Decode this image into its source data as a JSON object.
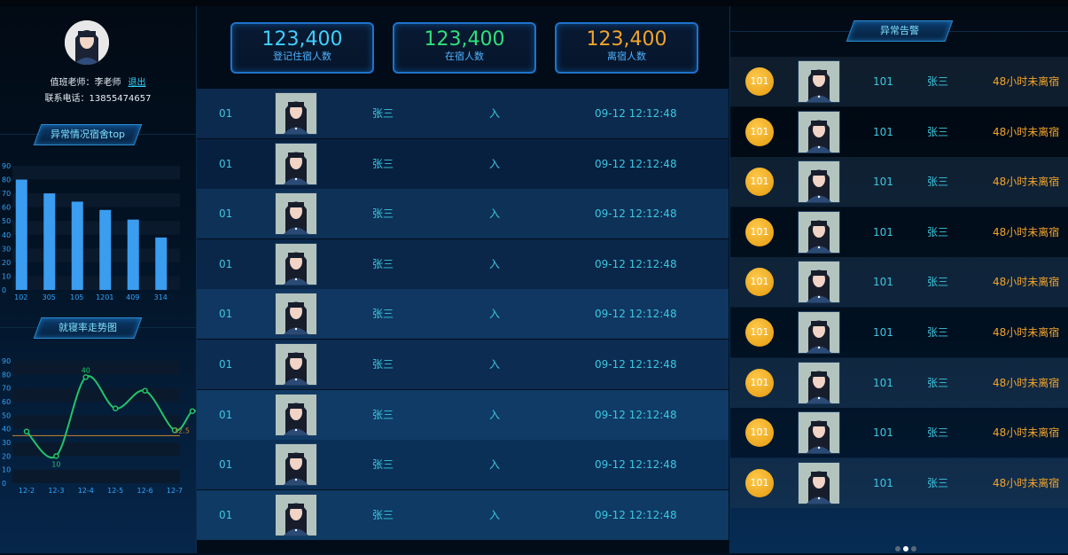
{
  "colors": {
    "accent": "#2fd6ff",
    "bar": "#3a9df0",
    "line": "#22c46b",
    "alert": "#f2a42a",
    "card1": "#3fd0ff",
    "card2": "#2fe07a",
    "card3": "#f2a42a"
  },
  "profile": {
    "teacher_label": "值班老师：李老师",
    "logout_label": "退出",
    "phone_label": "联系电话：13855474657"
  },
  "left": {
    "top_title": "异常情况宿舍top",
    "trend_title": "就寝率走势图"
  },
  "stats": [
    {
      "value": "123,400",
      "label": "登记住宿人数"
    },
    {
      "value": "123,400",
      "label": "在宿人数"
    },
    {
      "value": "123,400",
      "label": "离宿人数"
    }
  ],
  "records": [
    {
      "id": "01",
      "name": "张三",
      "dir": "入",
      "time": "09-12 12:12:48"
    },
    {
      "id": "01",
      "name": "张三",
      "dir": "入",
      "time": "09-12 12:12:48"
    },
    {
      "id": "01",
      "name": "张三",
      "dir": "入",
      "time": "09-12 12:12:48"
    },
    {
      "id": "01",
      "name": "张三",
      "dir": "入",
      "time": "09-12 12:12:48"
    },
    {
      "id": "01",
      "name": "张三",
      "dir": "入",
      "time": "09-12 12:12:48"
    },
    {
      "id": "01",
      "name": "张三",
      "dir": "入",
      "time": "09-12 12:12:48"
    },
    {
      "id": "01",
      "name": "张三",
      "dir": "入",
      "time": "09-12 12:12:48"
    },
    {
      "id": "01",
      "name": "张三",
      "dir": "入",
      "time": "09-12 12:12:48"
    },
    {
      "id": "01",
      "name": "张三",
      "dir": "入",
      "time": "09-12 12:12:48"
    }
  ],
  "alerts": {
    "title": "异常告警",
    "items": [
      {
        "badge": "101",
        "room": "101",
        "name": "张三",
        "msg": "48小时未离宿"
      },
      {
        "badge": "101",
        "room": "101",
        "name": "张三",
        "msg": "48小时未离宿"
      },
      {
        "badge": "101",
        "room": "101",
        "name": "张三",
        "msg": "48小时未离宿"
      },
      {
        "badge": "101",
        "room": "101",
        "name": "张三",
        "msg": "48小时未离宿"
      },
      {
        "badge": "101",
        "room": "101",
        "name": "张三",
        "msg": "48小时未离宿"
      },
      {
        "badge": "101",
        "room": "101",
        "name": "张三",
        "msg": "48小时未离宿"
      },
      {
        "badge": "101",
        "room": "101",
        "name": "张三",
        "msg": "48小时未离宿"
      },
      {
        "badge": "101",
        "room": "101",
        "name": "张三",
        "msg": "48小时未离宿"
      },
      {
        "badge": "101",
        "room": "101",
        "name": "张三",
        "msg": "48小时未离宿"
      }
    ]
  },
  "pager": {
    "pages": 3,
    "active": 1
  },
  "chart_data": [
    {
      "type": "bar",
      "title": "异常情况宿舍top",
      "categories": [
        "102",
        "305",
        "105",
        "1201",
        "409",
        "314"
      ],
      "values": [
        80,
        70,
        64,
        58,
        51,
        38
      ],
      "ylim": [
        0,
        90
      ],
      "yticks": [
        0,
        10,
        20,
        30,
        40,
        50,
        60,
        70,
        80,
        90
      ]
    },
    {
      "type": "line",
      "title": "就寝率走势图",
      "categories": [
        "12-2",
        "12-3",
        "12-4",
        "12-5",
        "12-6",
        "12-7"
      ],
      "series": [
        {
          "values": [
            38,
            20,
            78,
            55,
            68,
            39,
            53,
            49
          ]
        }
      ],
      "x_positions": [
        0,
        1,
        2,
        3,
        4,
        5,
        5.6,
        6
      ],
      "annotations": [
        {
          "text": "40"
        },
        {
          "text": "10"
        },
        {
          "text": "32.5"
        }
      ],
      "reference_line": 35,
      "ylim": [
        0,
        90
      ],
      "yticks": [
        0,
        10,
        20,
        30,
        40,
        50,
        60,
        70,
        80,
        90
      ]
    }
  ]
}
